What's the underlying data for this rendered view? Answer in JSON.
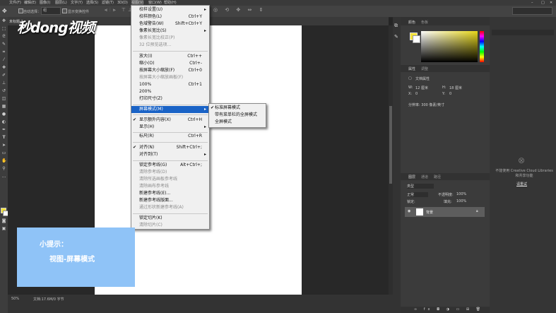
{
  "menubar": {
    "items": [
      "文件(F)",
      "编辑(E)",
      "图像(I)",
      "图层(L)",
      "文字(Y)",
      "选择(S)",
      "滤镜(T)",
      "3D(D)",
      "视图(V)",
      "窗口(W)",
      "帮助(H)"
    ]
  },
  "optbar": {
    "autoselect": "自动选择：",
    "group": "组",
    "transform": "显示变换控件"
  },
  "doc": {
    "tab": "未标题-1",
    "zoom": "50%",
    "status": "文档:17.6M/0 字节"
  },
  "watermark": "秒dong视频",
  "view_menu": {
    "items": [
      {
        "label": "校样设置(U)",
        "shortcut": "",
        "arrow": true
      },
      {
        "label": "校样颜色(L)",
        "shortcut": "Ctrl+Y"
      },
      {
        "label": "色域警告(W)",
        "shortcut": "Shift+Ctrl+Y"
      },
      {
        "label": "像素长宽比(S)",
        "shortcut": "",
        "arrow": true
      },
      {
        "label": "像素长宽比校正(P)",
        "shortcut": "",
        "disabled": true
      },
      {
        "label": "32 位预览选项...",
        "shortcut": "",
        "disabled": true
      },
      {
        "label": "放大(I)",
        "shortcut": "Ctrl++"
      },
      {
        "label": "缩小(O)",
        "shortcut": "Ctrl+-"
      },
      {
        "label": "按屏幕大小缩放(F)",
        "shortcut": "Ctrl+0"
      },
      {
        "label": "按屏幕大小缩放画板(F)",
        "shortcut": "",
        "disabled": true
      },
      {
        "label": "100%",
        "shortcut": "Ctrl+1"
      },
      {
        "label": "200%",
        "shortcut": ""
      },
      {
        "label": "打印尺寸(Z)",
        "shortcut": ""
      },
      {
        "label": "屏幕模式(M)",
        "shortcut": "",
        "arrow": true,
        "highlighted": true
      },
      {
        "label": "显示额外内容(X)",
        "shortcut": "Ctrl+H",
        "checked": true
      },
      {
        "label": "显示(H)",
        "shortcut": "",
        "arrow": true
      },
      {
        "label": "标尺(R)",
        "shortcut": "Ctrl+R"
      },
      {
        "label": "对齐(N)",
        "shortcut": "Shift+Ctrl+;",
        "checked": true
      },
      {
        "label": "对齐到(T)",
        "shortcut": "",
        "arrow": true
      },
      {
        "label": "锁定参考线(G)",
        "shortcut": "Alt+Ctrl+;"
      },
      {
        "label": "清除参考线(D)",
        "shortcut": "",
        "disabled": true
      },
      {
        "label": "清除所选画板参考线",
        "shortcut": "",
        "disabled": true
      },
      {
        "label": "清除画布参考线",
        "shortcut": "",
        "disabled": true
      },
      {
        "label": "新建参考线(E)...",
        "shortcut": ""
      },
      {
        "label": "新建参考线版面...",
        "shortcut": ""
      },
      {
        "label": "通过形状新建参考线(A)",
        "shortcut": "",
        "disabled": true
      },
      {
        "label": "锁定切片(K)",
        "shortcut": ""
      },
      {
        "label": "清除切片(C)",
        "shortcut": "",
        "disabled": true
      }
    ]
  },
  "screen_mode_menu": {
    "items": [
      {
        "label": "标准屏幕模式",
        "checked": true
      },
      {
        "label": "带有菜单栏的全屏模式",
        "checked": false
      },
      {
        "label": "全屏模式",
        "checked": false
      }
    ]
  },
  "tip": {
    "title": "小提示：",
    "body": "视图-屏幕模式"
  },
  "panels": {
    "color_tab": "颜色",
    "swatch_tab": "色板",
    "props_tab": "属性",
    "adjust_tab": "调整",
    "doc_props": "文档属性",
    "w_label": "W:",
    "w_val": "12 厘米",
    "h_label": "H:",
    "h_val": "18 厘米",
    "x_label": "X:",
    "x_val": "0",
    "y_label": "Y:",
    "y_val": "0",
    "resolution": "分辨率: 300 像素/英寸",
    "layers_tab": "图层",
    "channels_tab": "通道",
    "paths_tab": "路径",
    "layer_kind": "类型",
    "blend_mode": "正常",
    "opacity_label": "不透明度:",
    "opacity_val": "100%",
    "lock_label": "锁定:",
    "fill_label": "填充:",
    "fill_val": "100%",
    "layer_name": "背景"
  },
  "libraries": {
    "message": "不能使用 Creative Cloud Libraries 和共享功能",
    "retry": "请重试"
  }
}
